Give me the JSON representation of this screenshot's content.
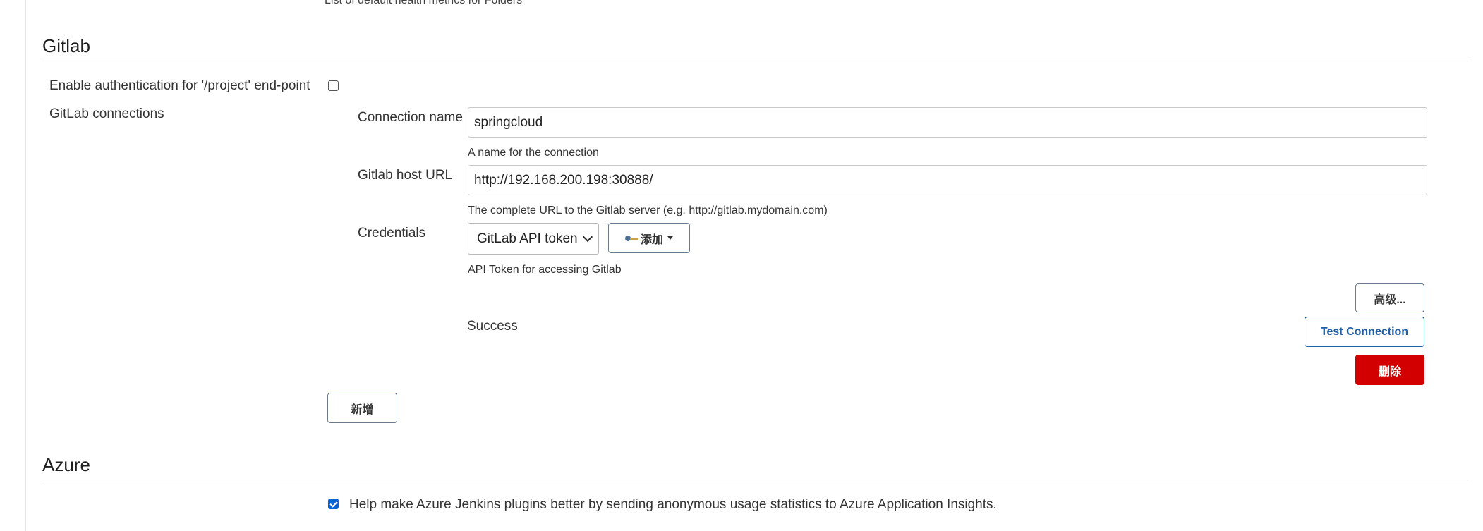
{
  "top_description": "List of default health metrics for Folders",
  "gitlab": {
    "title": "Gitlab",
    "enable_auth_label": "Enable authentication for '/project' end-point",
    "enable_auth_checked": false,
    "connections_label": "GitLab connections",
    "connection": {
      "name_label": "Connection name",
      "name_value": "springcloud",
      "name_help": "A name for the connection",
      "host_label": "Gitlab host URL",
      "host_value": "http://192.168.200.198:30888/",
      "host_help": "The complete URL to the Gitlab server (e.g. http://gitlab.mydomain.com)",
      "credentials_label": "Credentials",
      "credentials_selected": "GitLab API token",
      "add_button": "添加",
      "credentials_help": "API Token for accessing Gitlab",
      "advanced_button": "高级...",
      "status": "Success",
      "test_button": "Test Connection",
      "delete_button": "删除"
    },
    "new_button": "新增"
  },
  "azure": {
    "title": "Azure",
    "usage_label": "Help make Azure Jenkins plugins better by sending anonymous usage statistics to Azure Application Insights.",
    "usage_checked": true
  },
  "colors": {
    "primary": "#1f5fa8",
    "danger": "#d20000",
    "checkbox": "#0b64d6"
  }
}
